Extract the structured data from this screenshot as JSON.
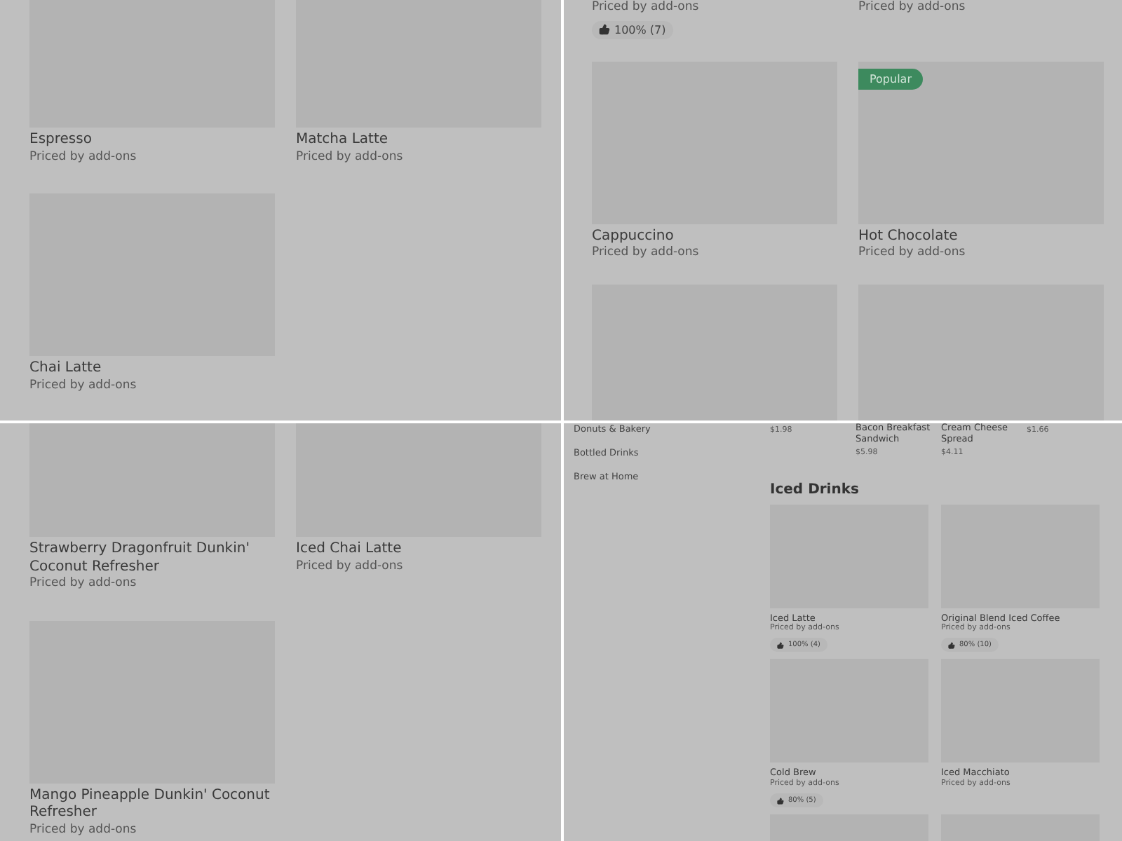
{
  "panels": [
    {
      "kind": "grid",
      "rows": [
        [
          {
            "kind": "card",
            "name": "Espresso",
            "price": "Priced by add-ons"
          },
          {
            "kind": "card",
            "name": "Matcha Latte",
            "price": "Priced by add-ons"
          }
        ],
        [
          {
            "kind": "card",
            "name": "Chai Latte",
            "price": "Priced by add-ons"
          }
        ]
      ]
    },
    {
      "kind": "grid",
      "rows": [
        [
          {
            "kind": "text_only",
            "price": "Priced by add-ons",
            "rating": "100% (7)"
          },
          {
            "kind": "text_only",
            "price": "Priced by add-ons"
          }
        ],
        [
          {
            "kind": "card",
            "name": "Cappuccino",
            "price": "Priced by add-ons"
          },
          {
            "kind": "card",
            "badge": "Popular",
            "name": "Hot Chocolate",
            "price": "Priced by add-ons"
          }
        ],
        [
          {
            "kind": "image_only"
          },
          {
            "kind": "image_only"
          }
        ]
      ]
    },
    {
      "kind": "grid",
      "rows": [
        [
          {
            "kind": "card",
            "name": "Strawberry Dragonfruit Dunkin' Coconut Refresher",
            "price": "Priced by add-ons"
          },
          {
            "kind": "card",
            "name": "Iced Chai Latte",
            "price": "Priced by add-ons"
          }
        ],
        [
          {
            "kind": "card",
            "name": "Mango Pineapple Dunkin' Coconut Refresher",
            "price": "Priced by add-ons"
          }
        ]
      ]
    },
    {
      "kind": "sidebar_menu",
      "sidebar": {
        "items": [
          "Donuts & Bakery",
          "Bottled Drinks",
          "Brew at Home"
        ]
      },
      "top_items": [
        {
          "price": "$1.98"
        },
        {
          "name": "Bacon Breakfast Sandwich",
          "price": "$5.98"
        },
        {
          "name": "Cream Cheese Spread",
          "price": "$4.11"
        },
        {
          "price": "$1.66"
        }
      ],
      "section": {
        "title": "Iced Drinks",
        "items": [
          {
            "kind": "card",
            "name": "Iced Latte",
            "price": "Priced by add-ons",
            "rating": "100% (4)"
          },
          {
            "kind": "card",
            "name": "Original Blend Iced Coffee",
            "price": "Priced by add-ons",
            "rating": "80% (10)"
          },
          {
            "kind": "card",
            "name": "Cold Brew",
            "price": "Priced by add-ons",
            "rating": "80% (5)"
          },
          {
            "kind": "card",
            "name": "Iced Macchiato",
            "price": "Priced by add-ons"
          },
          {
            "kind": "image_only"
          },
          {
            "kind": "image_only"
          }
        ]
      }
    }
  ]
}
